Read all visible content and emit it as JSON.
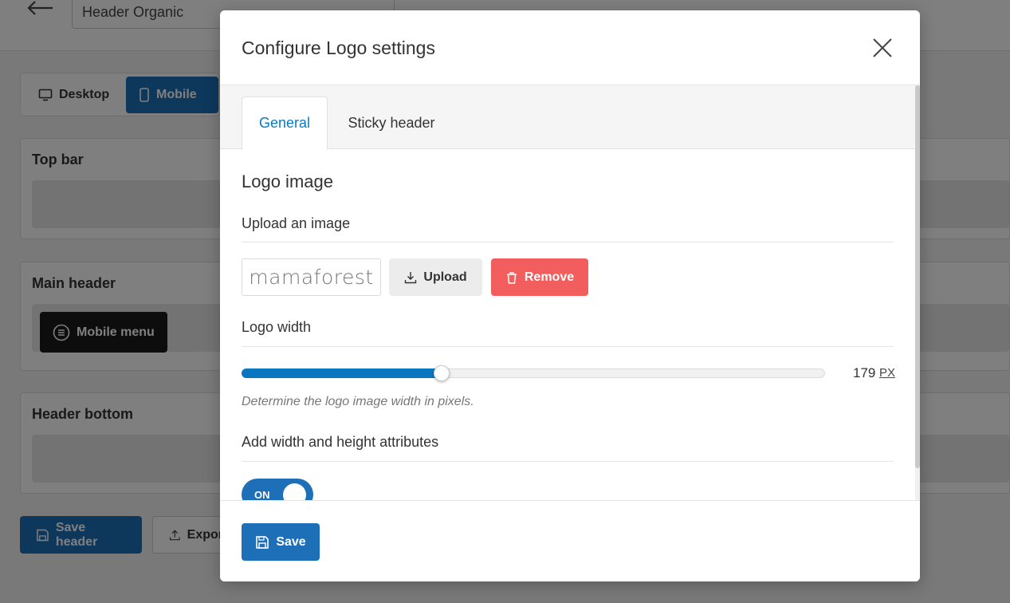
{
  "background": {
    "header_name": "Header Organic",
    "device_tabs": [
      "Desktop",
      "Mobile"
    ],
    "sections": [
      {
        "title": "Top bar"
      },
      {
        "title": "Main header",
        "chip": "Mobile menu"
      },
      {
        "title": "Header bottom"
      }
    ],
    "save_header_label": "Save header",
    "export_label": "Expor"
  },
  "modal": {
    "title": "Configure Logo settings",
    "tabs": [
      "General",
      "Sticky header"
    ],
    "active_tab": "General",
    "group_title": "Logo image",
    "upload_label": "Upload an image",
    "logo_text": "mamaforest",
    "upload_button": "Upload",
    "remove_button": "Remove",
    "width_label": "Logo width",
    "width_value": 179,
    "width_fraction": 0.343,
    "width_unit": "PX",
    "width_help": "Determine the logo image width in pixels.",
    "attributes_label": "Add width and height attributes",
    "toggle_state": "ON",
    "save_button": "Save"
  },
  "colors": {
    "primary": "#1d6fb8",
    "accent_tab": "#0b79c0",
    "danger": "#f25d5d",
    "slider_fill": "#0a76bf"
  },
  "icons": {
    "back": "arrow-left-icon",
    "desktop": "monitor-icon",
    "mobile": "phone-icon",
    "menu": "hamburger-circle-icon",
    "close": "close-icon",
    "upload": "download-icon",
    "remove": "trash-icon",
    "save": "floppy-disk-icon",
    "export": "upload-icon"
  }
}
